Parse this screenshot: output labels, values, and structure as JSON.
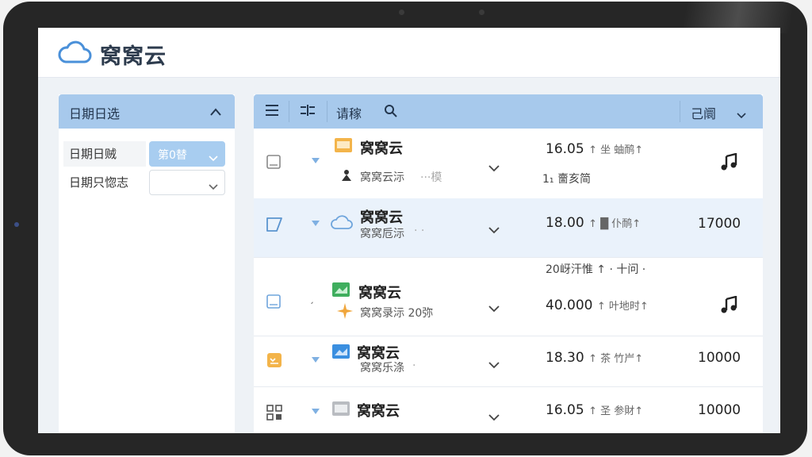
{
  "app": {
    "title": "窝窝云",
    "colors": {
      "accent": "#a7c9ec",
      "accent_strong": "#4a90d9",
      "header_text": "#23364e"
    }
  },
  "filter": {
    "title": "日期日选",
    "rows": [
      {
        "label": "日期日贼",
        "value": "第0替"
      },
      {
        "label": "日期只惚志",
        "value": ""
      }
    ]
  },
  "table": {
    "header": {
      "menu_icon": "menu-icon",
      "sort_icon": "sort-icon",
      "search_label": "请稼",
      "filter_icon": "filter-icon",
      "status_label": "己阛"
    },
    "rows": [
      {
        "check_icon": "checkbox-icon",
        "type_icon": "folder-icon-orange",
        "name": "窝窝云",
        "sub_icon": "user-icon",
        "sub": "窝窝云沶",
        "sub_extra": "···模",
        "primary": "16.05",
        "primary_rest": "↑ 坐 蚰鸸↑",
        "secondary": "1₁ 夁亥简",
        "value": "",
        "value_icon": "music-note-icon"
      },
      {
        "check_icon": "tag-icon",
        "type_icon": "cloud-icon",
        "name": "窝窝云",
        "sub": "窝窝卮沶",
        "sub_extra": "· ·",
        "primary": "18.00",
        "primary_rest": "↑ █ 仆鸸↑",
        "secondary": "20岈汗惟 ↑ · 十问 ·",
        "value": "17000",
        "value_icon": ""
      },
      {
        "check_icon": "checkbox-icon",
        "type_icon": "image-icon-green",
        "name": "窝窝云",
        "sub_icon": "sparkle-icon",
        "sub": "窝窝录沶 20弥",
        "sub_extra": "",
        "primary": "40.000",
        "primary_rest": "↑ 叶地时↑",
        "secondary": "",
        "value": "",
        "value_icon": "music-note-icon"
      },
      {
        "check_icon": "inbox-icon",
        "type_icon": "image-icon-blue",
        "name": "窝窝云",
        "sub": "窝窝乐涤",
        "sub_extra": "·",
        "primary": "18.30",
        "primary_rest": "↑ 茶 竹屵↑",
        "secondary": "",
        "value": "10000",
        "value_icon": ""
      },
      {
        "check_icon": "grid-icon",
        "type_icon": "image-icon-gray",
        "name": "窝窝云",
        "sub": "",
        "sub_extra": "",
        "primary": "16.05",
        "primary_rest": "↑ 圣 参財↑",
        "secondary": "",
        "value": "10000",
        "value_icon": ""
      }
    ]
  }
}
